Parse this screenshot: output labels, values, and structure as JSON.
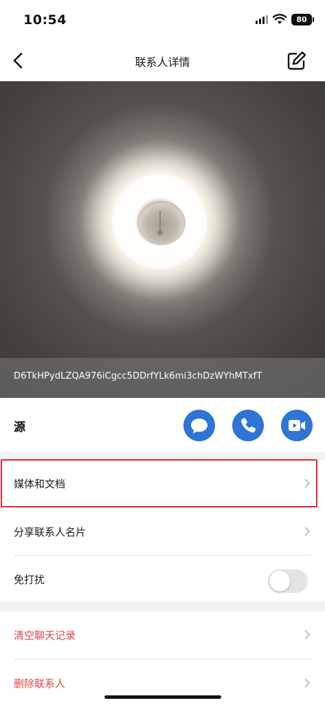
{
  "status_bar": {
    "time": "10:54",
    "battery": "80"
  },
  "nav": {
    "title": "联系人详情",
    "back_icon": "chevron-left-icon",
    "edit_icon": "edit-icon"
  },
  "contact": {
    "id": "D6TkHPydLZQA976iCgcc5DDrfYLk6mi3chDzWYhMTxfT",
    "name": "源"
  },
  "actions": [
    {
      "name": "message",
      "icon": "chat-bubble-icon"
    },
    {
      "name": "call",
      "icon": "phone-icon"
    },
    {
      "name": "video",
      "icon": "video-camera-icon"
    }
  ],
  "menu": {
    "media_docs": "媒体和文档",
    "share_card": "分享联系人名片",
    "dnd": "免打扰",
    "dnd_enabled": false
  },
  "danger": {
    "clear_chat": "清空聊天记录",
    "delete_contact": "删除联系人"
  },
  "colors": {
    "accent": "#2f74d6",
    "danger": "#d84a45",
    "highlight": "#e8262e"
  }
}
